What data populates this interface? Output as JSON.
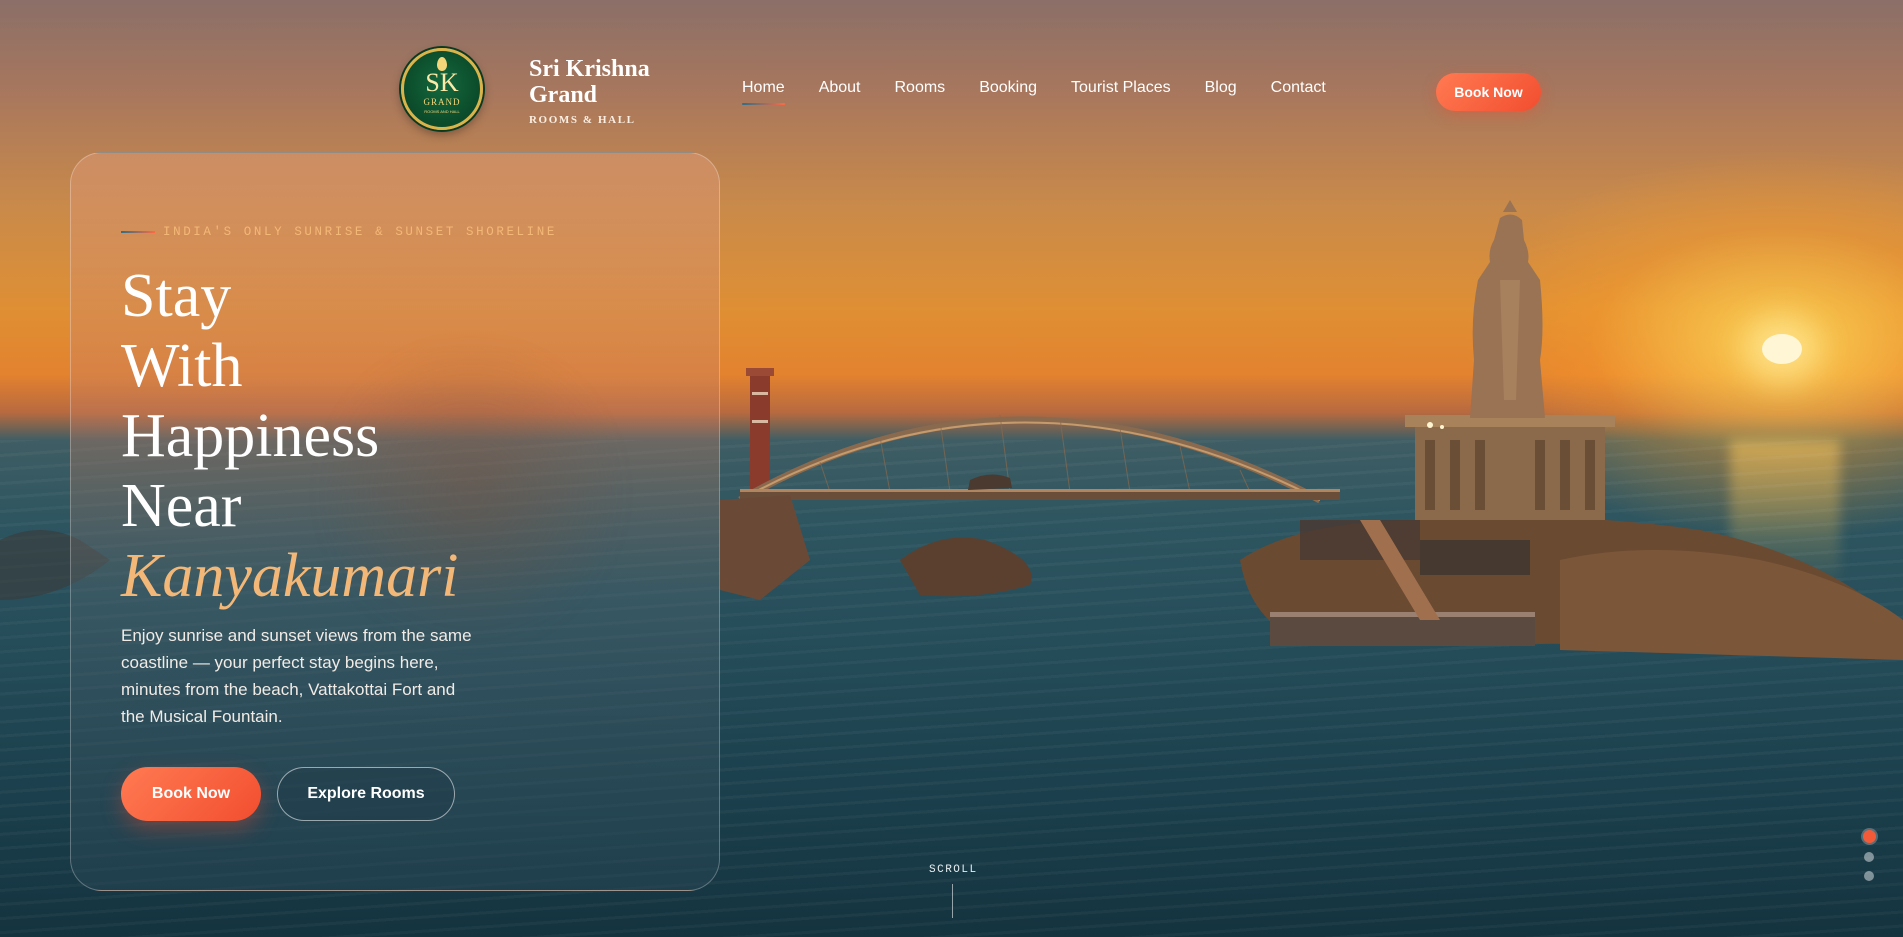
{
  "brand": {
    "logo_initials": "SK",
    "logo_word": "GRAND",
    "logo_sub": "ROOMS AND HALL",
    "name": "Sri Krishna Grand",
    "tagline": "ROOMS & HALL"
  },
  "nav": {
    "items": [
      {
        "label": "Home",
        "active": true
      },
      {
        "label": "About"
      },
      {
        "label": "Rooms"
      },
      {
        "label": "Booking"
      },
      {
        "label": "Tourist Places"
      },
      {
        "label": "Blog"
      },
      {
        "label": "Contact"
      }
    ],
    "cta_label": "Book Now"
  },
  "hero": {
    "eyebrow": "INDIA'S ONLY SUNRISE & SUNSET SHORELINE",
    "headline_lines": [
      "Stay",
      "With",
      "Happiness",
      "Near"
    ],
    "headline_accent": "Kanyakumari",
    "description": "Enjoy sunrise and sunset views from the same coastline — your perfect stay begins here, minutes from the beach, Vattakottai Fort and the Musical Fountain.",
    "primary_label": "Book Now",
    "secondary_label": "Explore Rooms"
  },
  "scroll_label": "SCROLL",
  "slider": {
    "count": 3,
    "active": 0
  },
  "colors": {
    "accent": "#f25a38",
    "gold": "#f3b877",
    "logo_green": "#0b4a2a"
  }
}
